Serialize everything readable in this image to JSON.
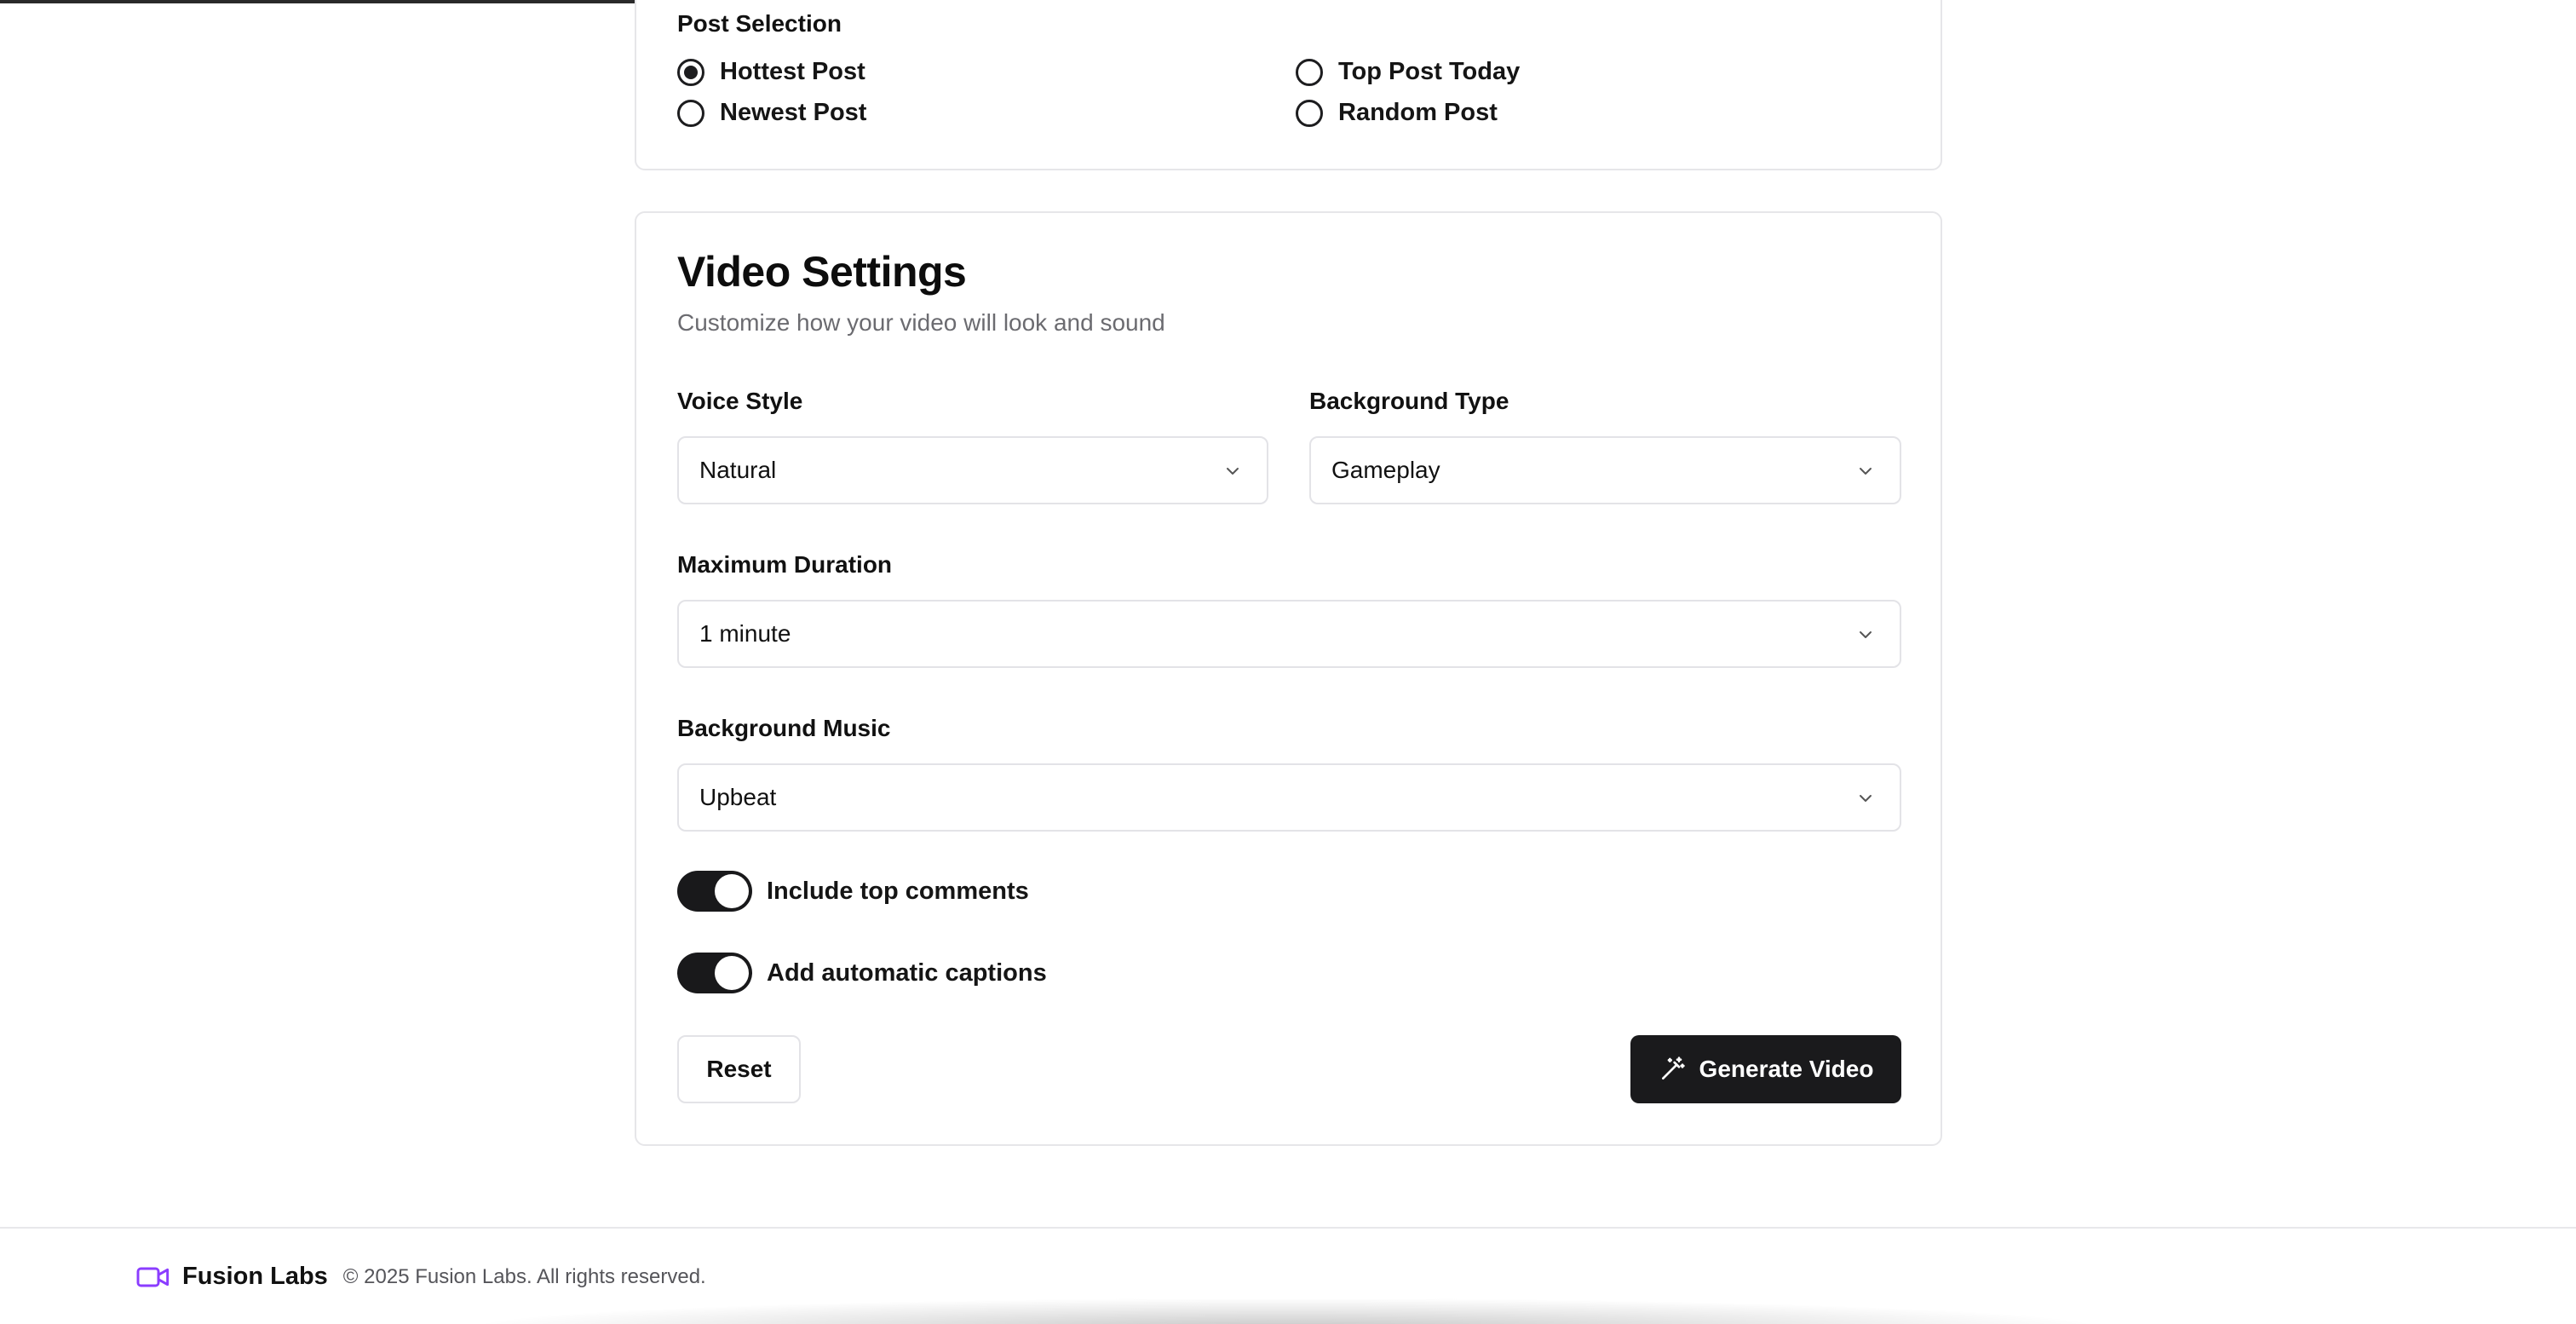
{
  "post_selection": {
    "label": "Post Selection",
    "options": [
      {
        "label": "Hottest Post",
        "selected": true
      },
      {
        "label": "Top Post Today",
        "selected": false
      },
      {
        "label": "Newest Post",
        "selected": false
      },
      {
        "label": "Random Post",
        "selected": false
      }
    ]
  },
  "video_settings": {
    "title": "Video Settings",
    "subtitle": "Customize how your video will look and sound",
    "voice_style": {
      "label": "Voice Style",
      "value": "Natural"
    },
    "background_type": {
      "label": "Background Type",
      "value": "Gameplay"
    },
    "max_duration": {
      "label": "Maximum Duration",
      "value": "1 minute"
    },
    "background_music": {
      "label": "Background Music",
      "value": "Upbeat"
    },
    "toggles": [
      {
        "label": "Include top comments",
        "on": true
      },
      {
        "label": "Add automatic captions",
        "on": true
      }
    ],
    "reset_label": "Reset",
    "generate_label": "Generate Video"
  },
  "footer": {
    "brand": "Fusion Labs",
    "copyright": "© 2025 Fusion Labs. All rights reserved.",
    "brand_icon": "video-camera-icon",
    "brand_color": "#8b3dff"
  },
  "colors": {
    "primary": "#1a1a1c",
    "border": "#e3e3e7",
    "muted_text": "#6b6b70"
  }
}
